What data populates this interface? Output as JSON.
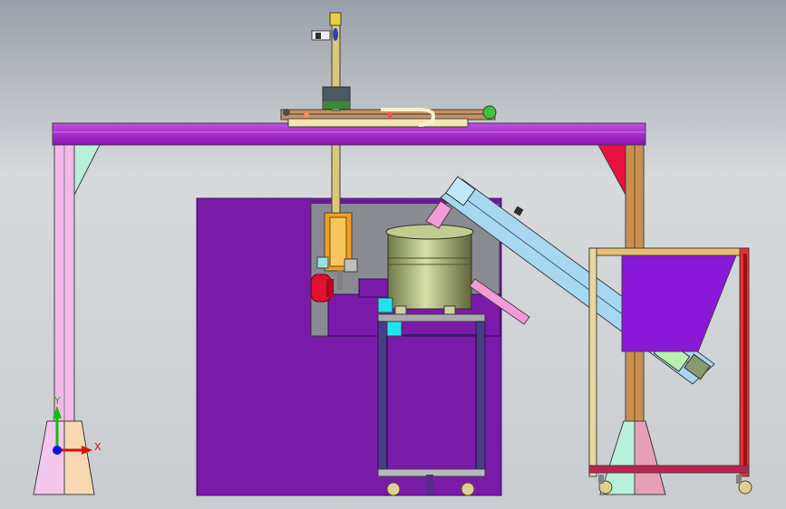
{
  "viewport": {
    "background_top": "#9aa0a8",
    "background_mid": "#d7dadd",
    "background_bottom": "#c9ccd0"
  },
  "colors": {
    "gantry_beam": "#a020c8",
    "gantry_beam_light": "#c050e0",
    "left_post": "#f4b8e8",
    "left_brace": "#b8f0dc",
    "right_post": "#c89050",
    "right_brace": "#e8103c",
    "machine_body": "#7a1aa8",
    "machine_inset": "#6a6a72",
    "vertical_axis": "#d8c878",
    "bowl": "#9aa86a",
    "conveyor": "#a8d8f0",
    "hopper_frame": "#e85050",
    "hopper": "#8a18d8",
    "stand_frame": "#3a2a7a",
    "cyan_block": "#22e0f0",
    "red_motor": "#e01030",
    "chute_pink": "#f49ad8"
  },
  "triad": {
    "x_label": "X",
    "y_label": "Y",
    "x_color": "#e01010",
    "y_color": "#10c010",
    "z_color": "#1010e0"
  }
}
